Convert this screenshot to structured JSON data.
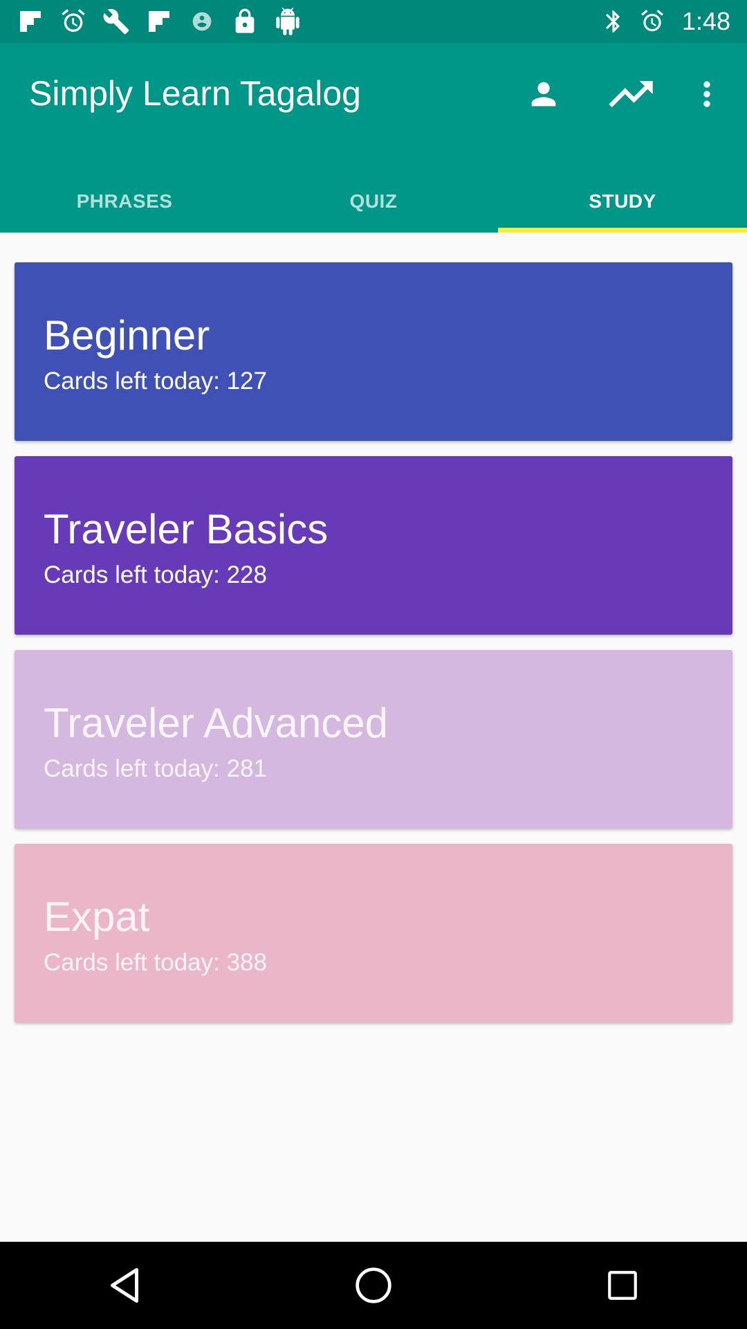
{
  "status_bar": {
    "time": "1:48",
    "left_icons": [
      "flipboard-icon",
      "alarm-icon",
      "wrench-icon",
      "flipboard-icon",
      "sync-icon",
      "lock-icon",
      "android-icon"
    ],
    "right_icons": [
      "bluetooth-icon",
      "alarm-icon"
    ]
  },
  "app_bar": {
    "title": "Simply Learn Tagalog",
    "actions": [
      "person-icon",
      "trending-up-icon",
      "more-vert-icon"
    ],
    "background": "#009688",
    "tab_indicator": "#ffeb3b"
  },
  "tabs": [
    {
      "label": "PHRASES",
      "active": false
    },
    {
      "label": "QUIZ",
      "active": false
    },
    {
      "label": "STUDY",
      "active": true
    }
  ],
  "decks": [
    {
      "title": "Beginner",
      "subtitle": "Cards left today: 127",
      "color": "#3f51b5"
    },
    {
      "title": "Traveler Basics",
      "subtitle": "Cards left today: 228",
      "color": "#673ab7"
    },
    {
      "title": "Traveler Advanced",
      "subtitle": "Cards left today: 281",
      "color": "#d5b8df"
    },
    {
      "title": "Expat",
      "subtitle": "Cards left today: 388",
      "color": "#ebb6c7"
    }
  ],
  "nav_bar": [
    "back-icon",
    "home-icon",
    "recents-icon"
  ]
}
